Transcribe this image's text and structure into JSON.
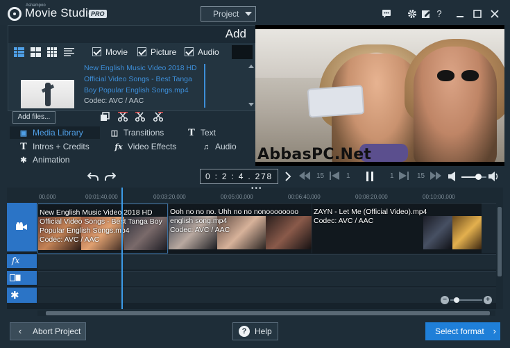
{
  "titlebar": {
    "brand_small": "Ashampoo",
    "brand": "Movie Studio",
    "brand_badge": "PRO",
    "project_menu": "Project",
    "icons": [
      "chat-icon",
      "gear-icon",
      "edit-icon",
      "help-icon",
      "minimize-icon",
      "maximize-icon",
      "close-icon"
    ],
    "help_glyph": "?"
  },
  "media_panel": {
    "header": "Add",
    "filters": [
      {
        "label": "Movie",
        "checked": true
      },
      {
        "label": "Picture",
        "checked": true
      },
      {
        "label": "Audio",
        "checked": true
      }
    ],
    "item": {
      "title": "New English Music Video 2018 HD Official Video Songs - Best Tanga Boy Popular English Songs.mp4",
      "codec": "Codec: AVC / AAC"
    },
    "add_files": "Add files..."
  },
  "tabs": [
    {
      "label": "Media Library",
      "icon": "film-icon",
      "active": true
    },
    {
      "label": "Transitions",
      "icon": "transitions-icon",
      "active": false
    },
    {
      "label": "Text",
      "icon": "text-icon",
      "active": false
    },
    {
      "label": "Intros + Credits",
      "icon": "text-icon",
      "active": false
    },
    {
      "label": "Video Effects",
      "icon": "fx-icon",
      "active": false
    },
    {
      "label": "Audio",
      "icon": "music-icon",
      "active": false
    },
    {
      "label": "Animation",
      "icon": "animation-icon",
      "active": false
    }
  ],
  "preview": {
    "watermark": "AbbasPC.Net"
  },
  "transport": {
    "timecode": "0 : 2 : 4 . 278",
    "skip_back_value": "15",
    "frame_back_value": "1",
    "frame_fwd_value": "1",
    "skip_fwd_value": "15",
    "volume": 0.66
  },
  "timeline": {
    "ruler": [
      "00,000",
      "00:01:40,000",
      "00:03:20,000",
      "00:05:00,000",
      "00:06:40,000",
      "00:08:20,000",
      "00:10:00,000"
    ],
    "clips": [
      {
        "label": "New English Music Video 2018 HD Official Video Songs - Best Tanga Boy Popular English Songs.mp4",
        "codec": "Codec: AVC / AAC"
      },
      {
        "label": "Ooh no no no. Uhh no no nonoooooooo english song.mp4",
        "codec": "Codec: AVC / AAC"
      },
      {
        "label": "ZAYN - Let Me (Official Video).mp4",
        "codec": "Codec: AVC / AAC"
      }
    ],
    "zoom_minus": "−",
    "zoom_plus": "+"
  },
  "footer": {
    "abort": "Abort Project",
    "help": "Help",
    "select": "Select format",
    "help_glyph": "?",
    "back_chevron": "‹",
    "next_chevron": "›"
  }
}
